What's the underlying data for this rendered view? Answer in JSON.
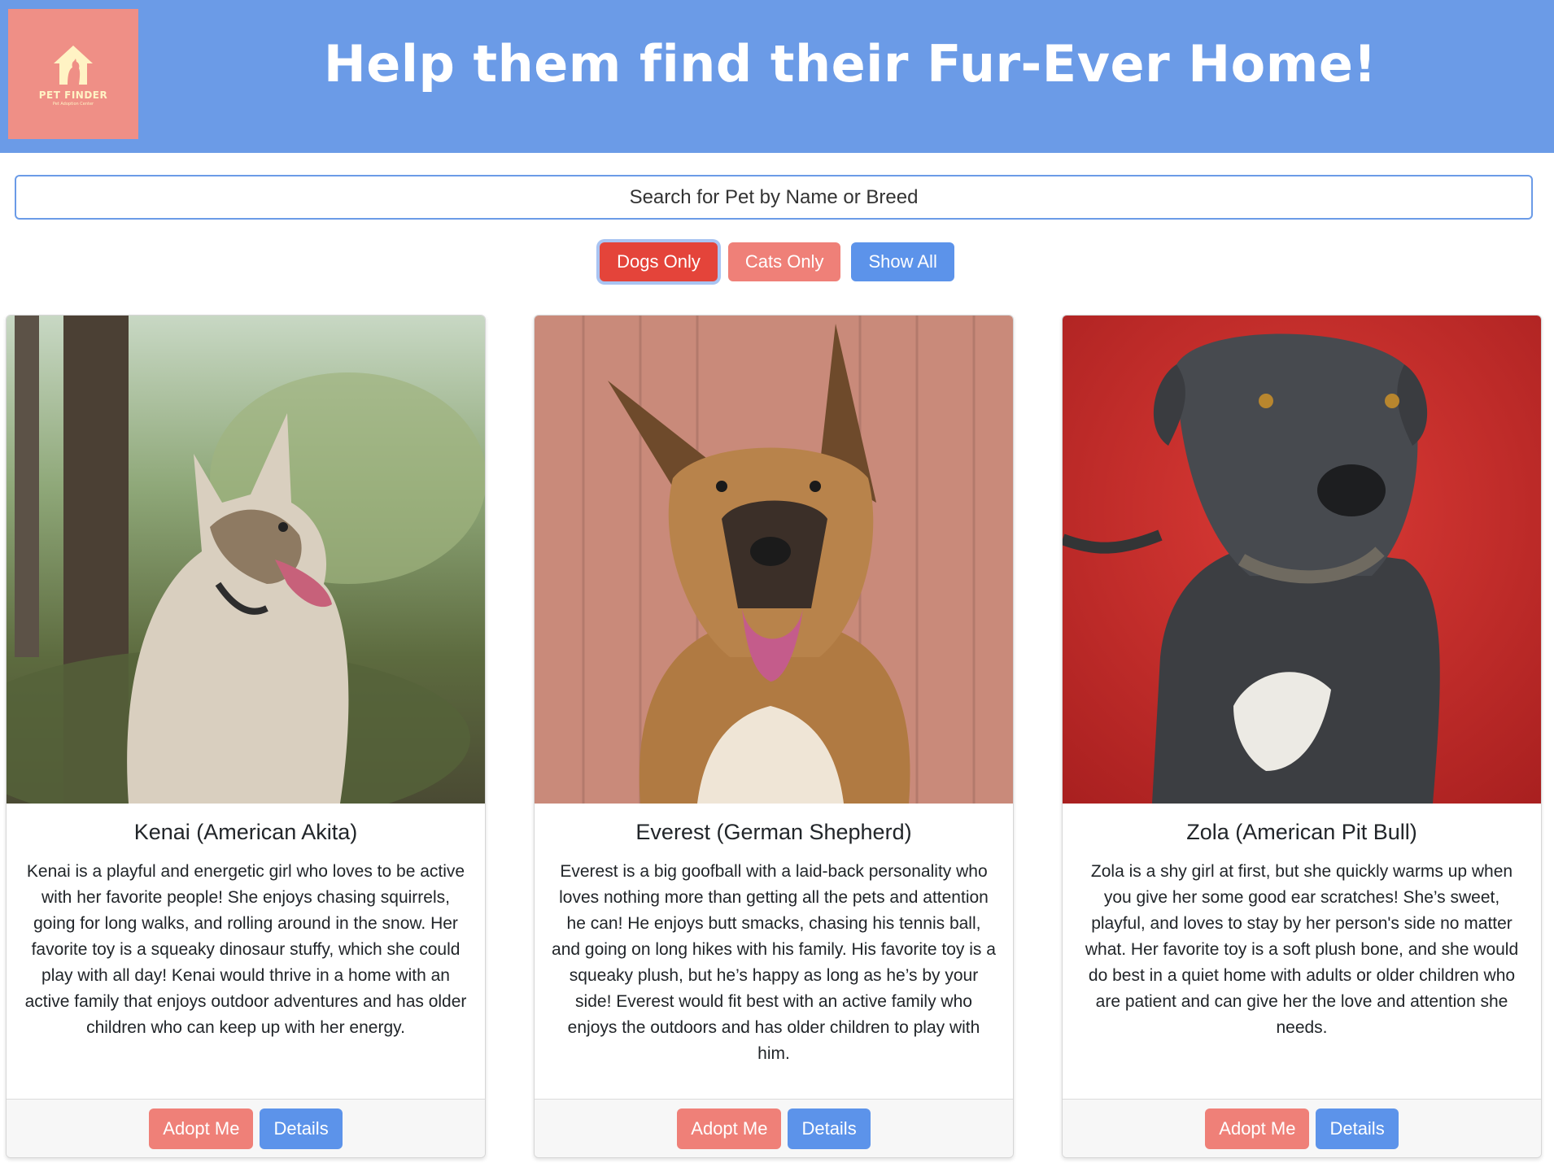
{
  "header": {
    "logo_title": "PET FINDER",
    "logo_subtitle": "Pet Adoption Center",
    "headline": "Help them find their Fur-Ever Home!"
  },
  "search": {
    "placeholder": "Search for Pet by Name or Breed"
  },
  "filters": {
    "dogs_label": "Dogs Only",
    "cats_label": "Cats Only",
    "all_label": "Show All",
    "active": "Dogs Only"
  },
  "colors": {
    "header_bg": "#6b9be7",
    "logo_bg": "#ef8f86",
    "dogs_active": "#e4443a",
    "cats": "#ef8078",
    "primary_blue": "#5c93ea"
  },
  "pets": [
    {
      "title": "Kenai (American Akita)",
      "description": "Kenai is a playful and energetic girl who loves to be active with her favorite people! She enjoys chasing squirrels, going for long walks, and rolling around in the snow. Her favorite toy is a squeaky dinosaur stuffy, which she could play with all day! Kenai would thrive in a home with an active family that enjoys outdoor adventures and has older children who can keep up with her energy.",
      "adopt_label": "Adopt Me",
      "details_label": "Details"
    },
    {
      "title": "Everest (German Shepherd)",
      "description": "Everest is a big goofball with a laid-back personality who loves nothing more than getting all the pets and attention he can! He enjoys butt smacks, chasing his tennis ball, and going on long hikes with his family. His favorite toy is a squeaky plush, but he’s happy as long as he’s by your side! Everest would fit best with an active family who enjoys the outdoors and has older children to play with him.",
      "adopt_label": "Adopt Me",
      "details_label": "Details"
    },
    {
      "title": "Zola (American Pit Bull)",
      "description": "Zola is a shy girl at first, but she quickly warms up when you give her some good ear scratches! She’s sweet, playful, and loves to stay by her person's side no matter what. Her favorite toy is a soft plush bone, and she would do best in a quiet home with adults or older children who are patient and can give her the love and attention she needs.",
      "adopt_label": "Adopt Me",
      "details_label": "Details"
    }
  ]
}
